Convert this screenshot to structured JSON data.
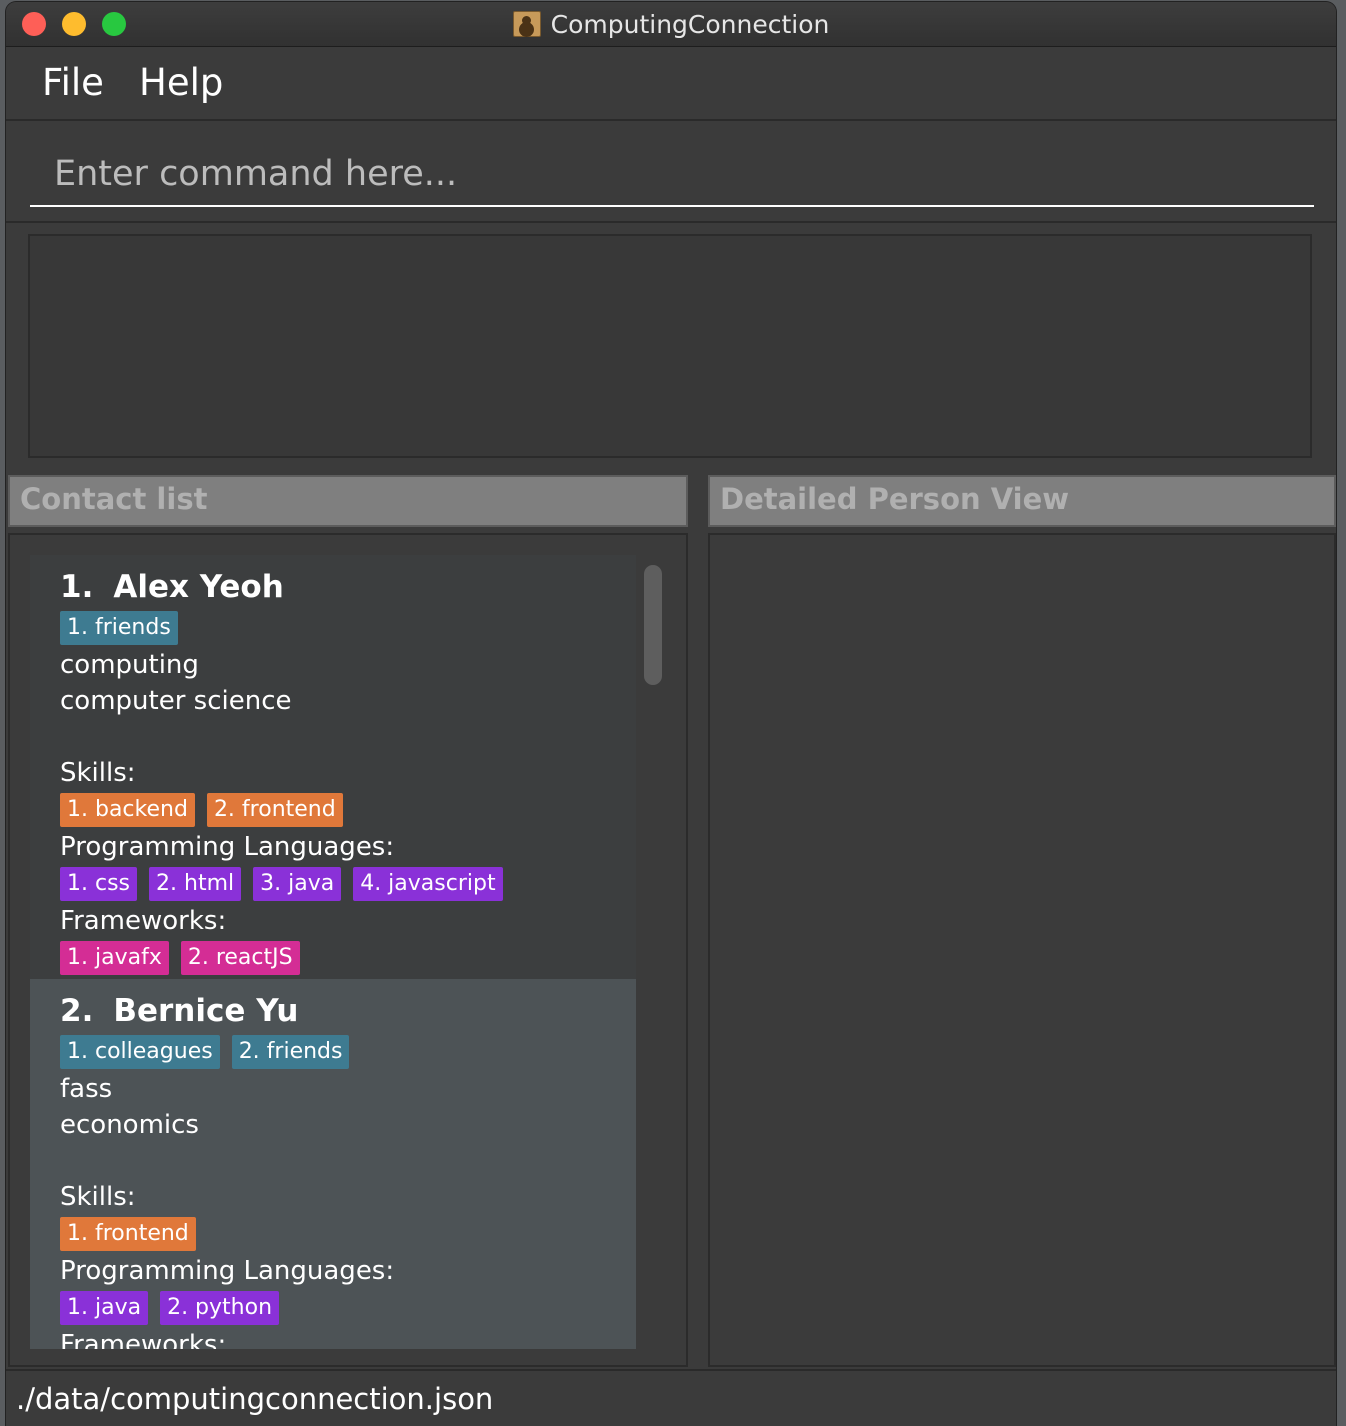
{
  "window": {
    "title": "ComputingConnection"
  },
  "menu": {
    "file": "File",
    "help": "Help"
  },
  "command": {
    "placeholder": "Enter command here...",
    "value": ""
  },
  "result": {
    "text": ""
  },
  "panels": {
    "contact_list": "Contact list",
    "detail_view": "Detailed Person View"
  },
  "contacts": [
    {
      "index": "1.",
      "name": "Alex Yeoh",
      "groups": [
        "1. friends"
      ],
      "faculty": "computing",
      "major": "computer science",
      "skills_label": "Skills:",
      "skills": [
        "1. backend",
        "2. frontend"
      ],
      "languages_label": "Programming Languages:",
      "languages": [
        "1. css",
        "2. html",
        "3. java",
        "4. javascript"
      ],
      "frameworks_label": "Frameworks:",
      "frameworks": [
        "1. javafx",
        "2. reactJS"
      ]
    },
    {
      "index": "2.",
      "name": "Bernice Yu",
      "groups": [
        "1. colleagues",
        "2. friends"
      ],
      "faculty": "fass",
      "major": "economics",
      "skills_label": "Skills:",
      "skills": [
        "1. frontend"
      ],
      "languages_label": "Programming Languages:",
      "languages": [
        "1. java",
        "2. python"
      ],
      "frameworks_label": "Frameworks:",
      "frameworks": []
    }
  ],
  "status": {
    "file_path": "./data/computingconnection.json"
  },
  "colors": {
    "group_tag": "#3e7b91",
    "skill_tag": "#e0783a",
    "language_tag": "#8a31d8",
    "framework_tag": "#d42d95",
    "selected_card": "#4d5356"
  }
}
